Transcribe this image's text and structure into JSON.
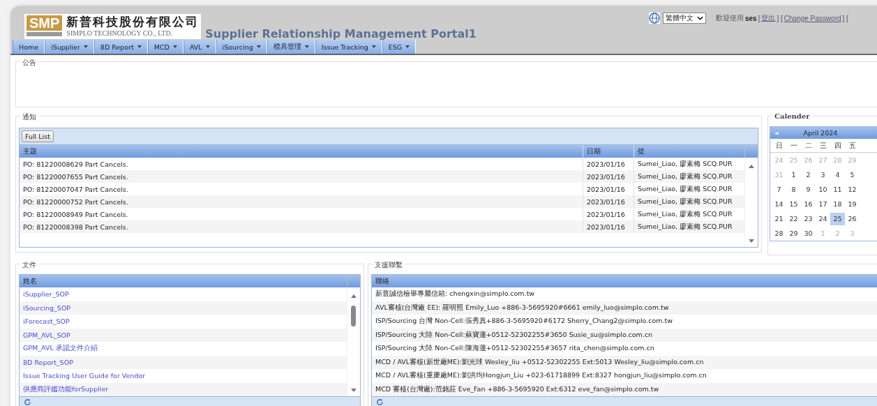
{
  "header": {
    "company_name": "新普科技股份有限公司",
    "company_name_en": "SIMPLO TECHNOLOGY CO., LTD.",
    "logo_text": "SMP",
    "portal_title": "Supplier Relationship Management Portal1",
    "language": "繁體中文",
    "account_bar": [
      {
        "kind": "text",
        "text": "歡迎使用"
      },
      {
        "kind": "user",
        "text": "ses"
      },
      {
        "kind": "text",
        "text": "["
      },
      {
        "kind": "link",
        "text": "登出"
      },
      {
        "kind": "text",
        "text": "] ["
      },
      {
        "kind": "link",
        "text": "Change Password"
      },
      {
        "kind": "text",
        "text": "] ["
      }
    ]
  },
  "nav": [
    {
      "label": "Home",
      "has_menu": false
    },
    {
      "label": "iSupplier",
      "has_menu": true
    },
    {
      "label": "8D Report",
      "has_menu": true
    },
    {
      "label": "MCD",
      "has_menu": true
    },
    {
      "label": "AVL",
      "has_menu": true
    },
    {
      "label": "iSourcing",
      "has_menu": true
    },
    {
      "label": "模具管理",
      "has_menu": true
    },
    {
      "label": "Issue Tracking",
      "has_menu": true
    },
    {
      "label": "ESG",
      "has_menu": true
    }
  ],
  "announcement": {
    "title": "公告"
  },
  "notifications": {
    "title": "通知",
    "button": "Full List",
    "columns": [
      "主題",
      "日期",
      "從"
    ],
    "rows": [
      [
        "PO: 81220008629 Part Cancels.",
        "2023/01/16",
        "Sumei_Liao, 廖素梅 SCQ.PUR"
      ],
      [
        "PO: 81220007655 Part Cancels.",
        "2023/01/16",
        "Sumei_Liao, 廖素梅 SCQ.PUR"
      ],
      [
        "PO: 81220007047 Part Cancels.",
        "2023/01/16",
        "Sumei_Liao, 廖素梅 SCQ.PUR"
      ],
      [
        "PO: 81220000752 Part Cancels.",
        "2023/01/16",
        "Sumei_Liao, 廖素梅 SCQ.PUR"
      ],
      [
        "PO: 81220008949 Part Cancels.",
        "2023/01/16",
        "Sumei_Liao, 廖素梅 SCQ.PUR"
      ],
      [
        "PO: 81220008398 Part Cancels.",
        "2023/01/16",
        "Sumei_Liao, 廖素梅 SCQ.PUR"
      ]
    ]
  },
  "calendar": {
    "title": "Calender",
    "prev": "◄",
    "month": "April 2024",
    "weekdays": [
      "日",
      "一",
      "二",
      "三",
      "四",
      "五"
    ],
    "weeks": [
      [
        {
          "day": "24",
          "other_month": true,
          "selected": false
        },
        {
          "day": "25",
          "other_month": true,
          "selected": false
        },
        {
          "day": "26",
          "other_month": true,
          "selected": false
        },
        {
          "day": "27",
          "other_month": true,
          "selected": false
        },
        {
          "day": "28",
          "other_month": true,
          "selected": false
        },
        {
          "day": "29",
          "other_month": true,
          "selected": false
        }
      ],
      [
        {
          "day": "31",
          "other_month": true,
          "selected": false
        },
        {
          "day": "1",
          "other_month": false,
          "selected": false
        },
        {
          "day": "2",
          "other_month": false,
          "selected": false
        },
        {
          "day": "3",
          "other_month": false,
          "selected": false
        },
        {
          "day": "4",
          "other_month": false,
          "selected": false
        },
        {
          "day": "5",
          "other_month": false,
          "selected": false
        }
      ],
      [
        {
          "day": "7",
          "other_month": false,
          "selected": false
        },
        {
          "day": "8",
          "other_month": false,
          "selected": false
        },
        {
          "day": "9",
          "other_month": false,
          "selected": false
        },
        {
          "day": "10",
          "other_month": false,
          "selected": false
        },
        {
          "day": "11",
          "other_month": false,
          "selected": false
        },
        {
          "day": "12",
          "other_month": false,
          "selected": false
        }
      ],
      [
        {
          "day": "14",
          "other_month": false,
          "selected": false
        },
        {
          "day": "15",
          "other_month": false,
          "selected": false
        },
        {
          "day": "16",
          "other_month": false,
          "selected": false
        },
        {
          "day": "17",
          "other_month": false,
          "selected": false
        },
        {
          "day": "18",
          "other_month": false,
          "selected": false
        },
        {
          "day": "19",
          "other_month": false,
          "selected": false
        }
      ],
      [
        {
          "day": "21",
          "other_month": false,
          "selected": false
        },
        {
          "day": "22",
          "other_month": false,
          "selected": false
        },
        {
          "day": "23",
          "other_month": false,
          "selected": false
        },
        {
          "day": "24",
          "other_month": false,
          "selected": false
        },
        {
          "day": "25",
          "other_month": false,
          "selected": true
        },
        {
          "day": "26",
          "other_month": false,
          "selected": false
        }
      ],
      [
        {
          "day": "28",
          "other_month": false,
          "selected": false
        },
        {
          "day": "29",
          "other_month": false,
          "selected": false
        },
        {
          "day": "30",
          "other_month": false,
          "selected": false
        },
        {
          "day": "1",
          "other_month": true,
          "selected": false
        },
        {
          "day": "2",
          "other_month": true,
          "selected": false
        },
        {
          "day": "3",
          "other_month": true,
          "selected": false
        }
      ]
    ]
  },
  "documents": {
    "title": "文件",
    "column": "姓名",
    "rows": [
      "iSupplier_SOP",
      "iSourcing_SOP",
      "iForecast_SOP",
      "GPM_AVL_SOP",
      "GPM_AVL 承認文件介紹",
      "8D Report_SOP",
      "Issue Tracking User Guide for Vendor",
      "供應商評鑑功能forSupplier"
    ]
  },
  "support": {
    "title": "支援聯繫",
    "column": "聯絡",
    "rows": [
      "新普誠信檢舉專屬信箱: chengxin@simplo.com.tw",
      "AVL審核(台灣廠 EE): 羅明照 Emily_Luo +886-3-5695920#6661 emily_luo@simplo.com.tw",
      "ISP/Sourcing 台灣 Non-Cell:張秀真+886-3-5695920#6172 Sherry_Chang2@simplo.com.tw",
      "ISP/Sourcing 大陸 Non-Cell:蘇寶蓮+0512-52302255#3650 Susie_su@simplo.com.cn",
      "ISP/Sourcing 大陸 Non-Cell:陳海蓮+0512-52302255#3657 rita_chen@simplo.com.cn",
      "MCD / AVL審核(新世廠ME):劉光球 Wesley_liu +0512-52302255 Ext:5013 Wesley_liu@simplo.com.cn",
      "MCD / AVL審核(重慶廠ME):劉洪均Hongjun_Liu +023-61718899 Ext:8327 hongjun_liu@simplo.com.cn",
      "MCD 審核(台灣廠):范銘莊 Eve_Fan +886-3-5695920 Ext:6312 eve_fan@simplo.com.tw"
    ]
  }
}
